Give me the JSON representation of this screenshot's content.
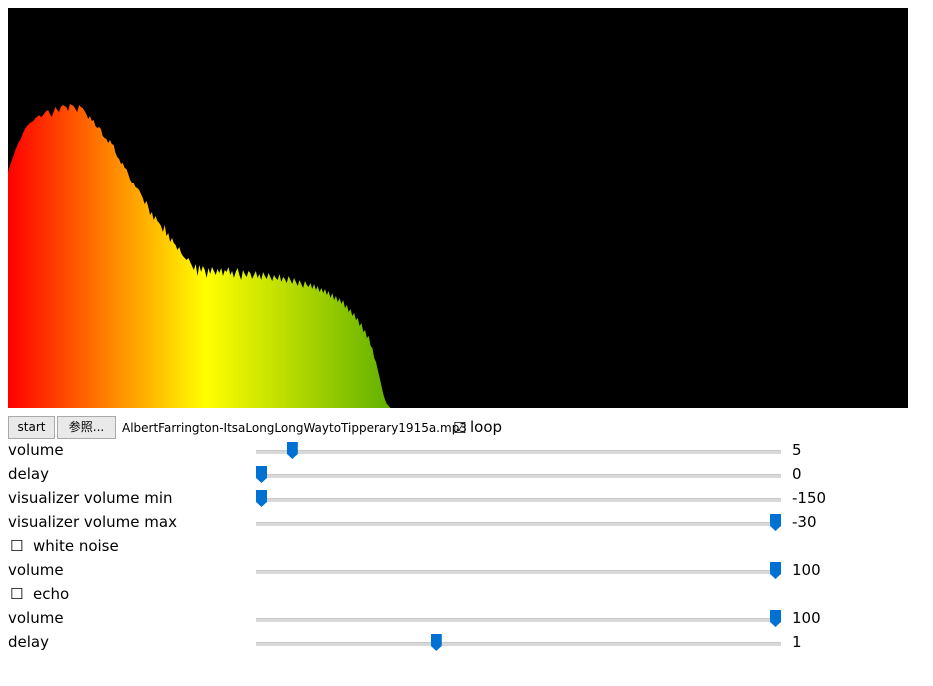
{
  "visualizer": {
    "spectrum": [
      236,
      242,
      247,
      252,
      258,
      262,
      266,
      269,
      274,
      278,
      281,
      283,
      285,
      286,
      287,
      290,
      291,
      293,
      291,
      292,
      295,
      297,
      298,
      294,
      291,
      296,
      301,
      298,
      296,
      301,
      303,
      302,
      301,
      297,
      304,
      303,
      302,
      299,
      296,
      303,
      301,
      300,
      297,
      294,
      289,
      292,
      287,
      288,
      282,
      280,
      281,
      279,
      272,
      270,
      269,
      265,
      268,
      264,
      263,
      255,
      251,
      249,
      244,
      245,
      240,
      239,
      234,
      228,
      225,
      225,
      221,
      220,
      218,
      214,
      210,
      204,
      207,
      201,
      193,
      196,
      188,
      192,
      187,
      185,
      182,
      176,
      183,
      172,
      175,
      166,
      170,
      165,
      163,
      158,
      161,
      155,
      152,
      150,
      148,
      150,
      146,
      142,
      138,
      144,
      132,
      143,
      136,
      142,
      138,
      130,
      140,
      134,
      141,
      137,
      133,
      139,
      135,
      140,
      132,
      138,
      136,
      141,
      133,
      137,
      130,
      136,
      140,
      133,
      128,
      138,
      134,
      131,
      137,
      135,
      129,
      133,
      137,
      130,
      134,
      128,
      136,
      132,
      129,
      135,
      131,
      127,
      133,
      130,
      128,
      134,
      126,
      131,
      129,
      125,
      132,
      128,
      124,
      130,
      126,
      122,
      128,
      124,
      120,
      127,
      123,
      121,
      125,
      119,
      124,
      118,
      122,
      116,
      120,
      115,
      119,
      113,
      117,
      110,
      115,
      108,
      112,
      106,
      110,
      104,
      108,
      100,
      103,
      96,
      99,
      92,
      95,
      88,
      90,
      82,
      85,
      76,
      78,
      70,
      72,
      62,
      60,
      50,
      46,
      38,
      30,
      22,
      14,
      8,
      4,
      2,
      0,
      0,
      0,
      0,
      0,
      0,
      0,
      0,
      0,
      0,
      0,
      0,
      0,
      0,
      0,
      0,
      0,
      0,
      0,
      0,
      0,
      0,
      0,
      0,
      0,
      0,
      0,
      0,
      0,
      0,
      0,
      0,
      0,
      0,
      0,
      0,
      0,
      0,
      0,
      0,
      0,
      0,
      0,
      0,
      0,
      0,
      0,
      0,
      0,
      0,
      0,
      0,
      0,
      0,
      0,
      0,
      0,
      0,
      0,
      0,
      0,
      0,
      0,
      0,
      0,
      0,
      0,
      0,
      0,
      0,
      0,
      0,
      0,
      0,
      0,
      0,
      0,
      0,
      0,
      0,
      0,
      0,
      0,
      0,
      0,
      0,
      0,
      0,
      0,
      0,
      0,
      0,
      0,
      0,
      0,
      0,
      0,
      0,
      0,
      0,
      0,
      0,
      0,
      0,
      0,
      0,
      0,
      0,
      0,
      0,
      0,
      0,
      0,
      0,
      0,
      0,
      0,
      0,
      0,
      0,
      0,
      0,
      0,
      0,
      0,
      0,
      0,
      0,
      0,
      0,
      0,
      0,
      0,
      0,
      0,
      0,
      0,
      0,
      0,
      0,
      0,
      0,
      0,
      0,
      0,
      0,
      0,
      0,
      0,
      0,
      0,
      0,
      0,
      0,
      0,
      0,
      0,
      0,
      0,
      0,
      0,
      0,
      0,
      0,
      0,
      0,
      0,
      0,
      0,
      0,
      0,
      0,
      0,
      0,
      0,
      0,
      0,
      0,
      0,
      0,
      0,
      0,
      0,
      0,
      0,
      0,
      0,
      0,
      0,
      0,
      0,
      0,
      0,
      0,
      0,
      0,
      0,
      0,
      0,
      0,
      0,
      0,
      0,
      0,
      0,
      0,
      0,
      0,
      0,
      0,
      0,
      0,
      0,
      0,
      0,
      0,
      0,
      0,
      0,
      0,
      0,
      0,
      0,
      0,
      0,
      0,
      0,
      0,
      0,
      0,
      0,
      0,
      0,
      0,
      0,
      0,
      0,
      0,
      0,
      0,
      0,
      0,
      0,
      0,
      0,
      0,
      0,
      0,
      0,
      0,
      0,
      0,
      0,
      0,
      0,
      0,
      0,
      0,
      0,
      0,
      0,
      0,
      0,
      0,
      0,
      0,
      0,
      0,
      0,
      0,
      0,
      0,
      0,
      0,
      0,
      0,
      0,
      0,
      0,
      0,
      0,
      0,
      0,
      0
    ],
    "colors": [
      "#ff0000",
      "#ff8c00",
      "#ffff00",
      "#008000",
      "#0030c0",
      "#0000ff"
    ]
  },
  "controls": {
    "start_label": "start",
    "browse_label": "参照...",
    "filename": "AlbertFarrington-ItsaLongLongWaytoTipperary1915a.mp3",
    "loop_checked": "☑",
    "loop_label": "loop"
  },
  "rows": [
    {
      "label": "volume",
      "value": "5",
      "fraction": 0.06
    },
    {
      "label": "delay",
      "value": "0",
      "fraction": 0.0
    },
    {
      "label": "visualizer volume min",
      "value": "-150",
      "fraction": 0.0
    },
    {
      "label": "visualizer volume max",
      "value": "-30",
      "fraction": 1.0
    },
    {
      "label": "white noise",
      "check": "☐"
    },
    {
      "label": "volume",
      "value": "100",
      "fraction": 1.0
    },
    {
      "label": "echo",
      "check": "☐"
    },
    {
      "label": "volume",
      "value": "100",
      "fraction": 1.0
    },
    {
      "label": "delay",
      "value": "1",
      "fraction": 0.34
    }
  ]
}
